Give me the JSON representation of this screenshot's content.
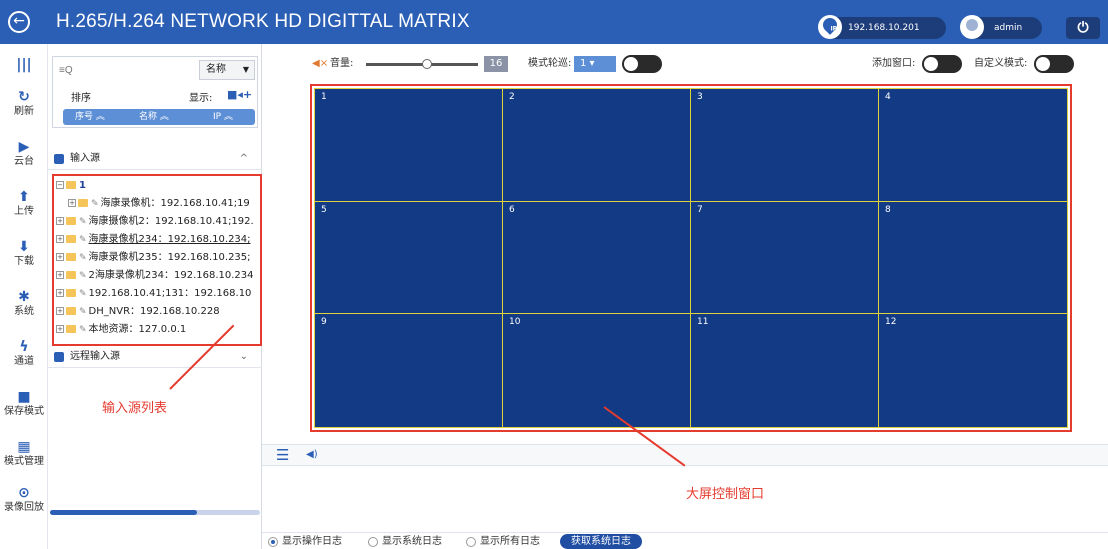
{
  "header": {
    "back_icon": "circle-arrow-left-icon",
    "title": "H.265/H.264 NETWORK HD DIGITTAL MATRIX",
    "ip_badge": "IP",
    "ip": "192.168.10.201",
    "user": "admin",
    "power_icon": "power-icon",
    "colors": {
      "bar": "#2b5fb5",
      "pill": "#1d3d7a"
    }
  },
  "nav": {
    "items": [
      {
        "icon": "columns-icon",
        "glyph": "|||",
        "label": ""
      },
      {
        "icon": "refresh-icon",
        "glyph": "↻",
        "label": "刷新"
      },
      {
        "icon": "ptz-camera-icon",
        "glyph": "▶",
        "label": "云台"
      },
      {
        "icon": "upload-icon",
        "glyph": "⬆",
        "label": "上传"
      },
      {
        "icon": "download-icon",
        "glyph": "⬇",
        "label": "下载"
      },
      {
        "icon": "gear-icon",
        "glyph": "✱",
        "label": "系统"
      },
      {
        "icon": "channel-icon",
        "glyph": "ϟ",
        "label": "通道"
      },
      {
        "icon": "save-icon",
        "glyph": "■",
        "label": "保存模式"
      },
      {
        "icon": "grid-icon",
        "glyph": "▦",
        "label": "模式管理"
      },
      {
        "icon": "playback-icon",
        "glyph": "⊙",
        "label": "录像回放"
      }
    ]
  },
  "panel": {
    "search_placeholder": "≡Q",
    "search_select": "名称",
    "sort_label": "排序",
    "show_label": "显示:",
    "show_icon": "camera-plus-icon",
    "sort_buttons": [
      "序号 ︽",
      "名称 ︽",
      "IP ︽"
    ],
    "input_section": "输入源",
    "remote_section": "远程输入源",
    "tree": {
      "root": "1",
      "items": [
        "海康录像机：192.168.10.41;19",
        "海康摄像机2：192.168.10.41;192.",
        "海康录像机234：192.168.10.234;",
        "海康录像机235：192.168.10.235;",
        "2海康录像机234：192.168.10.234",
        "192.168.10.41;131：192.168.10",
        "DH_NVR：192.168.10.228",
        "本地资源：127.0.0.1"
      ]
    },
    "progress": 0.7
  },
  "toolbar": {
    "volume_icon": "volume-muted-icon",
    "volume_label": "音量:",
    "volume_value": "16",
    "mode_cycle_label": "模式轮巡:",
    "mode_cycle_value": "1",
    "add_window_label": "添加窗口:",
    "custom_mode_label": "自定义模式:"
  },
  "screen": {
    "cells": [
      "1",
      "2",
      "3",
      "4",
      "5",
      "6",
      "7",
      "8",
      "9",
      "10",
      "11",
      "12"
    ]
  },
  "log": {
    "menu_icon": "hamburger-icon",
    "speaker_icon": "speaker-icon",
    "options": [
      "显示操作日志",
      "显示系统日志",
      "显示所有日志"
    ],
    "fetch_button": "获取系统日志"
  },
  "annotations": {
    "input_list": "输入源列表",
    "screen_window": "大屏控制窗口"
  }
}
